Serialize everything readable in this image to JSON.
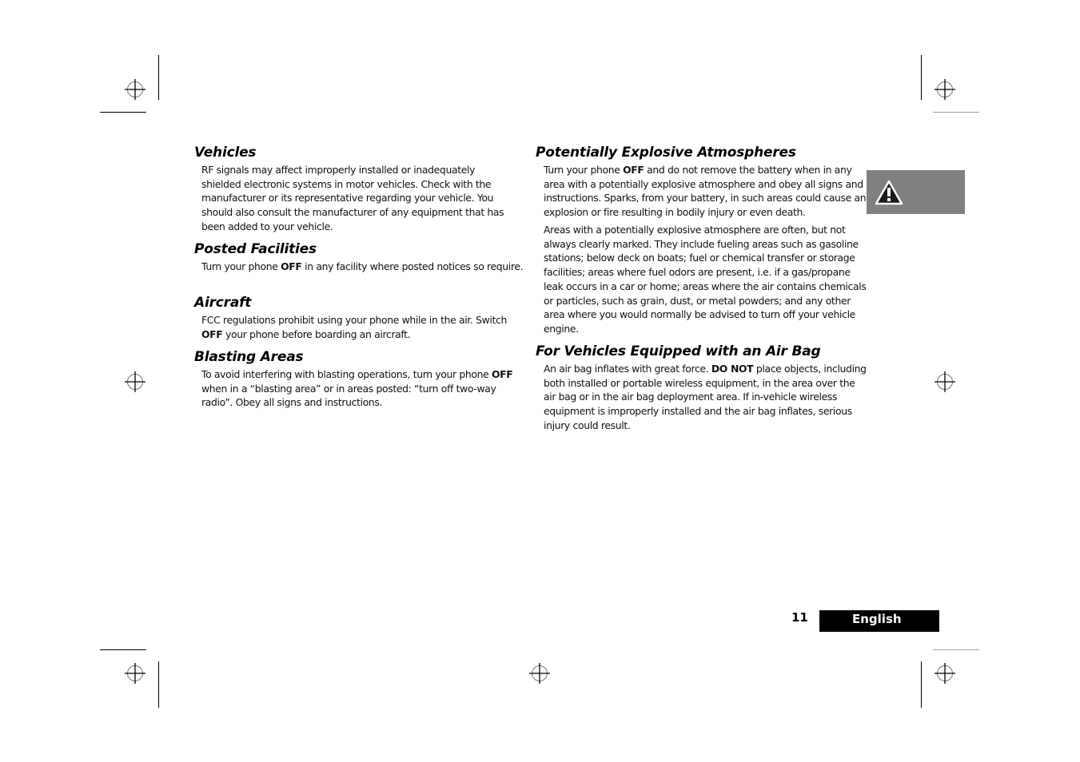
{
  "page": {
    "number": "11",
    "language_tab": "English",
    "warning_icon": "warning-triangle-icon"
  },
  "sections_left": [
    {
      "title": "Vehicles",
      "paragraphs": [
        {
          "lines": [
            "RF signals may affect improperly installed or inadequately",
            "shielded electronic systems in motor vehicles. Check with the",
            "manufacturer or its representative regarding your vehicle. You",
            "should also consult the manufacturer of any equipment that has",
            "been added to your vehicle."
          ]
        }
      ]
    },
    {
      "title": "Posted Facilities",
      "paragraphs": [
        {
          "pre": "Turn your phone ",
          "bold": "OFF",
          "post": " in any facility where posted notices so require."
        }
      ]
    },
    {
      "title": "Aircraft",
      "paragraphs": [
        {
          "pre": "FCC regulations prohibit using your phone while in the air. Switch ",
          "bold": "OFF",
          "post": " your phone before boarding an aircraft."
        }
      ]
    },
    {
      "title": "Blasting Areas",
      "paragraphs": [
        {
          "pre": "To avoid interfering with blasting operations, turn your phone ",
          "bold": "OFF",
          "post": " when in a “blasting area” or in areas posted: “turn off two-way radio”. Obey all signs and instructions."
        }
      ]
    }
  ],
  "sections_right": [
    {
      "title": "Potentially Explosive Atmospheres",
      "paragraphs": [
        {
          "pre": "Turn your phone ",
          "bold": "OFF",
          "post": " and do not remove the battery when in any area with a potentially explosive atmosphere and obey all signs and instructions. Sparks, from your battery, in such areas could cause an explosion or fire resulting in bodily injury or even death."
        },
        {
          "text": "Areas with a potentially explosive atmosphere are often, but not always clearly marked. They include fueling areas such as gasoline stations; below deck on boats; fuel or chemical transfer or storage facilities; areas where fuel odors are present, i.e. if a gas/propane leak occurs in a car or home; areas where the air contains chemicals or particles, such as grain, dust, or metal powders; and any other area where you would normally be advised to turn off your vehicle engine."
        }
      ]
    },
    {
      "title": "For Vehicles Equipped with an Air Bag",
      "paragraphs": [
        {
          "pre": "An air bag inflates with great force. ",
          "bold": "DO NOT",
          "post": " place objects, including both installed or portable wireless equipment, in the area over the air bag or in the air bag deployment area. If in-vehicle wireless equipment is improperly installed and the air bag inflates, serious injury could result."
        }
      ]
    }
  ]
}
